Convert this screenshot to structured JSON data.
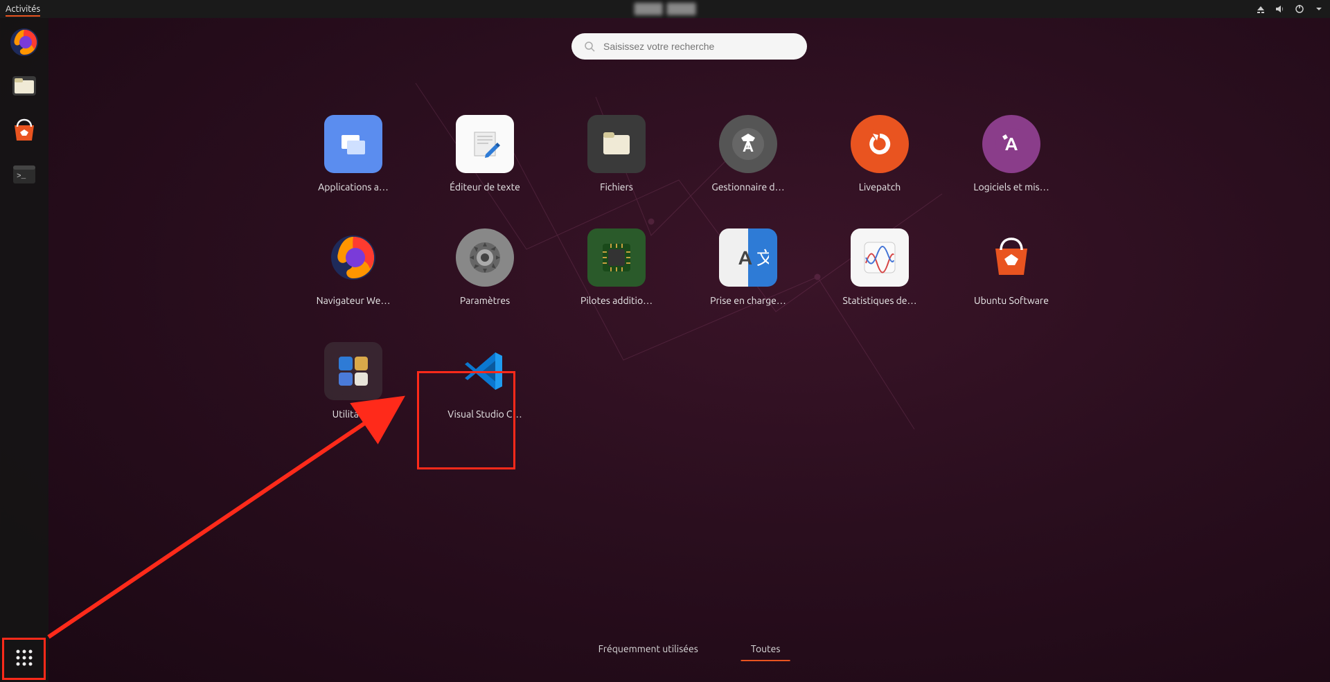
{
  "topbar": {
    "activities": "Activités",
    "status_icons": [
      "network-icon",
      "volume-icon",
      "power-icon",
      "chevron-down-icon"
    ]
  },
  "search": {
    "placeholder": "Saisissez votre recherche"
  },
  "dock": {
    "items": [
      {
        "name": "firefox",
        "label": "Firefox"
      },
      {
        "name": "files",
        "label": "Fichiers"
      },
      {
        "name": "ubuntu-software",
        "label": "Ubuntu Software"
      },
      {
        "name": "terminal",
        "label": "Terminal"
      }
    ],
    "show_apps": "Afficher les applications"
  },
  "apps": [
    {
      "id": "applications-additionnelles",
      "label": "Applications a…",
      "icon": "apps-extra-icon"
    },
    {
      "id": "editeur-de-texte",
      "label": "Éditeur de texte",
      "icon": "text-editor-icon"
    },
    {
      "id": "fichiers",
      "label": "Fichiers",
      "icon": "files-icon"
    },
    {
      "id": "gestionnaire-de-mises-a-jour",
      "label": "Gestionnaire d…",
      "icon": "update-manager-icon"
    },
    {
      "id": "livepatch",
      "label": "Livepatch",
      "icon": "livepatch-icon"
    },
    {
      "id": "logiciels-et-mises-a-jour",
      "label": "Logiciels et mis…",
      "icon": "software-updates-icon"
    },
    {
      "id": "navigateur-web",
      "label": "Navigateur We…",
      "icon": "firefox-icon"
    },
    {
      "id": "parametres",
      "label": "Paramètres",
      "icon": "settings-icon"
    },
    {
      "id": "pilotes-additionnels",
      "label": "Pilotes additio…",
      "icon": "drivers-icon"
    },
    {
      "id": "prise-en-charge-des-langues",
      "label": "Prise en charge…",
      "icon": "language-icon"
    },
    {
      "id": "statistiques-de-puissance",
      "label": "Statistiques de…",
      "icon": "power-stats-icon"
    },
    {
      "id": "ubuntu-software",
      "label": "Ubuntu Software",
      "icon": "ubuntu-software-icon"
    },
    {
      "id": "utilitaires",
      "label": "Utilitaires",
      "icon": "utilities-folder-icon",
      "is_folder": true
    },
    {
      "id": "visual-studio-code",
      "label": "Visual Studio C…",
      "icon": "vscode-icon"
    }
  ],
  "tabs": {
    "frequent": "Fréquemment utilisées",
    "all": "Toutes",
    "active": "all"
  },
  "annotation": {
    "arrow_from": "show-apps-button",
    "arrow_to": "visual-studio-code"
  },
  "colors": {
    "accent": "#e95420",
    "highlight": "#ff2a1a"
  }
}
